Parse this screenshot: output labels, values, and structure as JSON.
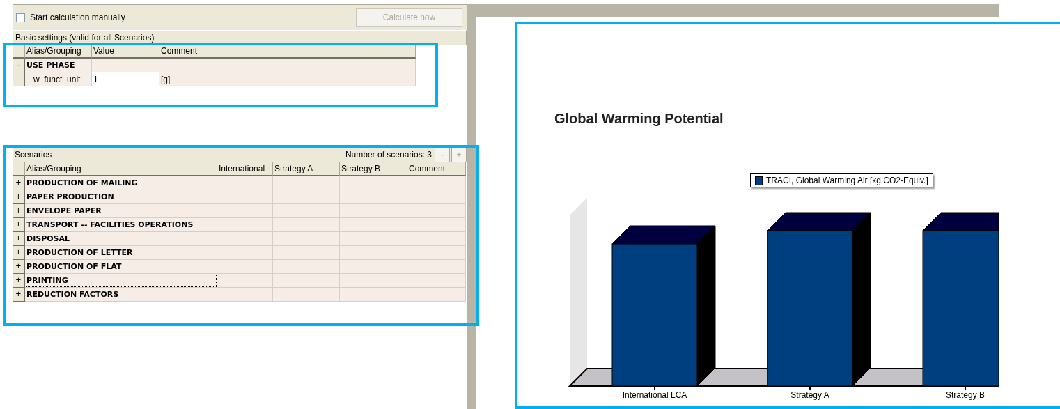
{
  "toolbar": {
    "manual_calculation": {
      "label": "Start calculation manually",
      "checked": false
    },
    "calculate_button": {
      "label": "Calculate now",
      "disabled": true
    }
  },
  "basic_settings": {
    "title": "Basic settings (valid for all Scenarios)",
    "columns": [
      "Alias/Grouping",
      "Value",
      "Comment"
    ],
    "rows": [
      {
        "kind": "group",
        "toggle": "-",
        "alias": "USE PHASE"
      },
      {
        "kind": "parameter",
        "alias": "w_funct_unit",
        "value": "1",
        "comment": "[g]"
      }
    ]
  },
  "scenarios": {
    "title": "Scenarios",
    "count_label": "Number of scenarios: 3",
    "buttons": [
      {
        "label": "-",
        "disabled": false
      },
      {
        "label": "+",
        "disabled": true
      }
    ],
    "columns": [
      "Alias/Grouping",
      "International",
      "Strategy A",
      "Strategy B",
      "Comment"
    ],
    "rows": [
      {
        "toggle": "+",
        "alias": "PRODUCTION OF MAILING",
        "focused": false
      },
      {
        "toggle": "+",
        "alias": "PAPER PRODUCTION",
        "focused": false
      },
      {
        "toggle": "+",
        "alias": "ENVELOPE PAPER",
        "focused": false
      },
      {
        "toggle": "+",
        "alias": "TRANSPORT -- FACILITIES OPERATIONS",
        "focused": false
      },
      {
        "toggle": "+",
        "alias": "DISPOSAL",
        "focused": false
      },
      {
        "toggle": "+",
        "alias": "PRODUCTION OF LETTER",
        "focused": false
      },
      {
        "toggle": "+",
        "alias": "PRODUCTION OF FLAT",
        "focused": false
      },
      {
        "toggle": "+",
        "alias": "PRINTING",
        "focused": true
      },
      {
        "toggle": "+",
        "alias": "REDUCTION FACTORS",
        "focused": false
      }
    ]
  },
  "chart": {
    "title": "Global Warming Potential",
    "legend": "TRACI, Global Warming Air [kg CO2-Equiv.]",
    "categories": [
      "International LCA",
      "Strategy A",
      "Strategy B"
    ]
  }
}
